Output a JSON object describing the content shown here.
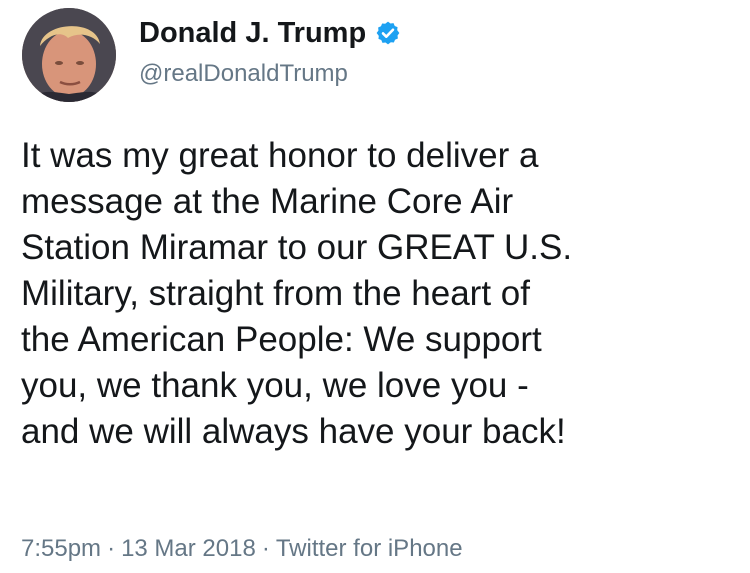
{
  "tweet": {
    "author": {
      "display_name": "Donald J. Trump",
      "handle": "@realDonaldTrump",
      "verified": true,
      "avatar_icon": "profile-photo"
    },
    "text_lines": [
      "It was my great honor to deliver a",
      "message at the Marine Core Air",
      "Station Miramar to our GREAT U.S.",
      "Military, straight from the heart of",
      "the American People: We support",
      "you, we thank you, we love you -",
      "and we will always have your back!"
    ],
    "meta": {
      "time": "7:55pm",
      "separator": "·",
      "date": "13 Mar 2018",
      "source": "Twitter for iPhone"
    }
  },
  "colors": {
    "text": "#14171a",
    "secondary": "#657786",
    "verified": "#1da1f2"
  }
}
